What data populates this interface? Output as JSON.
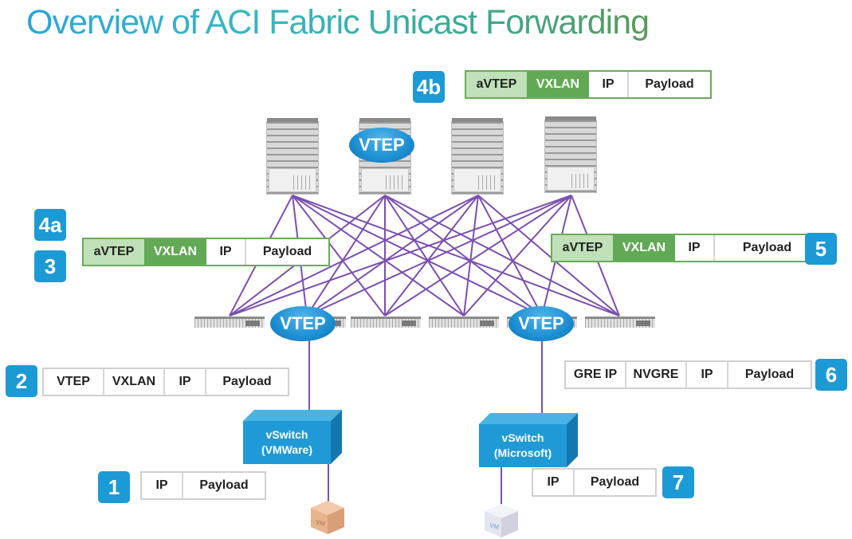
{
  "title": "Overview of ACI Fabric Unicast Forwarding",
  "colors": {
    "badge": "#1c9ad6",
    "link": "#7b4fb0",
    "vtep": "#1c8fd2",
    "avtep_cell": "#bfe0b8",
    "vxlan_green_cell": "#62a955",
    "vswitch": "#1f9ad7"
  },
  "fabric": {
    "spine_count": 4,
    "leaf_count": 6,
    "topology": "full-mesh",
    "spine_vtep_label": "VTEP",
    "leaf_vtep_labels": [
      "VTEP",
      "VTEP"
    ]
  },
  "steps": [
    {
      "badge": "1",
      "headers": [
        "IP",
        "Payload"
      ]
    },
    {
      "badge": "2",
      "headers": [
        "VTEP",
        "VXLAN",
        "IP",
        "Payload"
      ]
    },
    {
      "badge": "3",
      "headers": [
        "aVTEP",
        "VXLAN",
        "IP",
        "Payload"
      ]
    },
    {
      "badge": "4a",
      "headers": [
        "aVTEP",
        "VXLAN",
        "IP",
        "Payload"
      ]
    },
    {
      "badge": "4b",
      "headers": [
        "aVTEP",
        "VXLAN",
        "IP",
        "Payload"
      ]
    },
    {
      "badge": "5",
      "headers": [
        "aVTEP",
        "VXLAN",
        "IP",
        "Payload"
      ]
    },
    {
      "badge": "6",
      "headers": [
        "GRE IP",
        "NVGRE",
        "IP",
        "Payload"
      ]
    },
    {
      "badge": "7",
      "headers": [
        "IP",
        "Payload"
      ]
    }
  ],
  "vswitches": [
    {
      "line1": "vSwitch",
      "line2": "(VMWare)"
    },
    {
      "line1": "vSwitch",
      "line2": "(Microsoft)"
    }
  ],
  "vms": [
    {
      "label": "VM",
      "color": "#e8b48e"
    },
    {
      "label": "VM",
      "color": "#e4e6ef"
    }
  ]
}
